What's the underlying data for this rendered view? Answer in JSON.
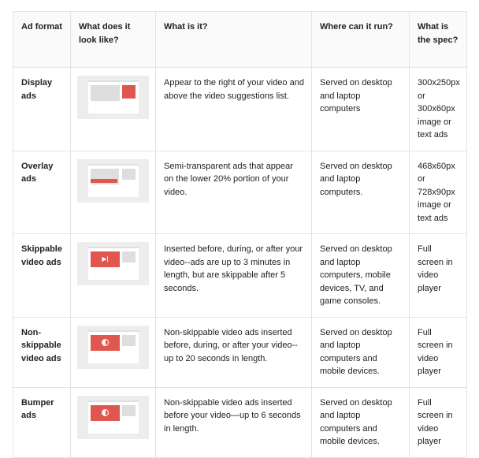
{
  "table": {
    "headers": [
      "Ad format",
      "What does it look like?",
      "What is it?",
      "Where can it run?",
      "What is the spec?"
    ],
    "rows": [
      {
        "format": "Display ads",
        "thumbnail": "display-ad-thumbnail",
        "what_is_it": "Appear to the right of your video and above the video suggestions list.",
        "where": "Served on desktop and laptop computers",
        "spec": "300x250px or 300x60px image or text ads"
      },
      {
        "format": "Overlay ads",
        "thumbnail": "overlay-ad-thumbnail",
        "what_is_it": "Semi-transparent ads that appear on the lower 20% portion of your video.",
        "where": "Served on desktop and laptop computers.",
        "spec": "468x60px or 728x90px image or text ads"
      },
      {
        "format": "Skippable video ads",
        "thumbnail": "skippable-video-ad-thumbnail",
        "what_is_it": "Inserted before, during, or after your video--ads are up to 3 minutes in length, but are skippable after 5 seconds.",
        "where": "Served on desktop and laptop computers, mobile devices, TV, and game consoles.",
        "spec": "Full screen in video player"
      },
      {
        "format": "Non-skippable video ads",
        "thumbnail": "non-skippable-video-ad-thumbnail",
        "what_is_it": "Non-skippable video ads inserted before, during, or after your video--up to 20 seconds in length.",
        "where": "Served on desktop and laptop computers and mobile devices.",
        "spec": "Full screen in video player"
      },
      {
        "format": "Bumper ads",
        "thumbnail": "bumper-ad-thumbnail",
        "what_is_it": "Non-skippable video ads inserted before your video—up to 6 seconds in length.",
        "where": "Served on desktop and laptop computers and mobile devices.",
        "spec": "Full screen in video player"
      }
    ]
  },
  "colors": {
    "accent_red": "#e0574f",
    "thumbnail_background": "#ededed",
    "border": "#e3e3e3",
    "header_background": "#fafafa",
    "text": "#202124"
  }
}
